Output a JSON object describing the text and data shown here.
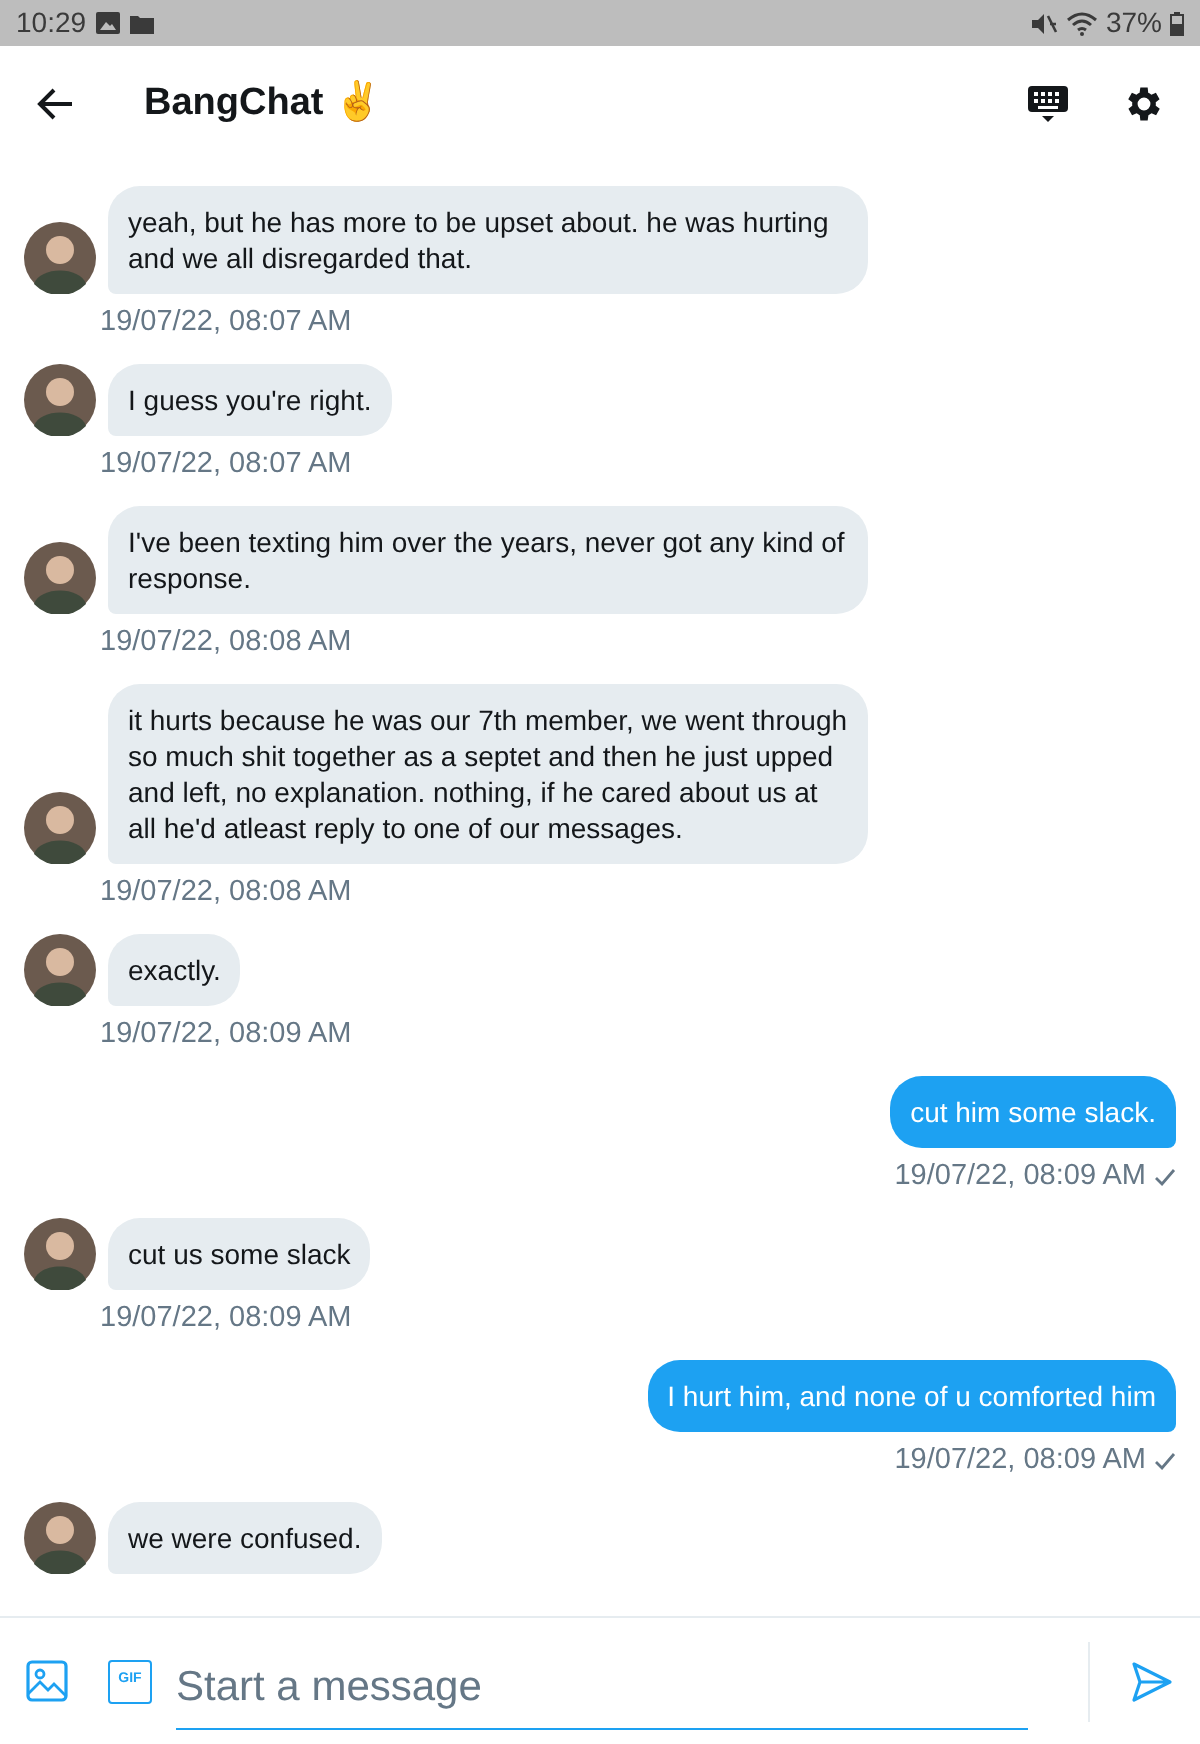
{
  "status_bar": {
    "time": "10:29",
    "battery": "37%"
  },
  "header": {
    "title": "BangChat ✌️"
  },
  "messages": [
    {
      "kind": "incoming",
      "text": "yeah, but he has more to be upset about. he was hurting and we all disregarded that.",
      "time": "19/07/22, 08:07 AM"
    },
    {
      "kind": "incoming",
      "text": "I guess you're right.",
      "time": "19/07/22, 08:07 AM"
    },
    {
      "kind": "incoming",
      "text": "I've been texting him over the years, never got any kind of response.",
      "time": "19/07/22, 08:08 AM"
    },
    {
      "kind": "incoming",
      "text": "it hurts because he was our 7th member, we went through so much shit together as a septet and then he just upped and left, no explanation. nothing, if he cared about us at all he'd atleast reply to one of our messages.",
      "time": "19/07/22, 08:08 AM"
    },
    {
      "kind": "incoming",
      "text": "exactly.",
      "time": "19/07/22, 08:09 AM"
    },
    {
      "kind": "outgoing",
      "text": "cut him some slack.",
      "time": "19/07/22, 08:09 AM",
      "sent": true
    },
    {
      "kind": "incoming",
      "text": "cut us some slack",
      "time": "19/07/22, 08:09 AM"
    },
    {
      "kind": "outgoing",
      "text": "I hurt him, and none of u comforted him",
      "time": "19/07/22, 08:09 AM",
      "sent": true
    },
    {
      "kind": "incoming",
      "text": "we were confused."
    }
  ],
  "composer": {
    "gif_label": "GIF",
    "placeholder": "Start a message"
  }
}
